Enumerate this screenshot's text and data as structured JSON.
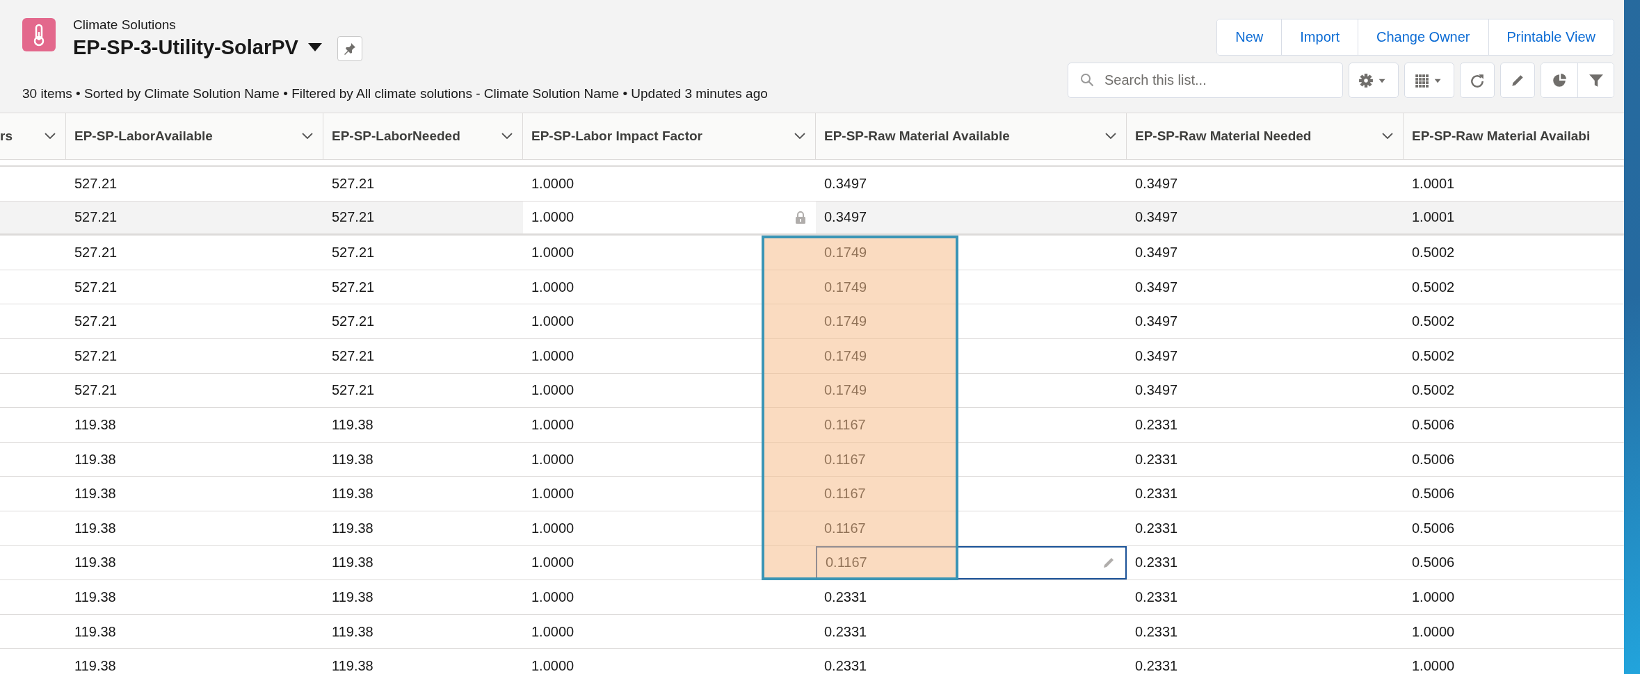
{
  "header": {
    "object_label": "Climate Solutions",
    "list_name": "EP-SP-3-Utility-SolarPV",
    "meta": "30 items • Sorted by Climate Solution Name • Filtered by All climate solutions - Climate Solution Name • Updated 3 minutes ago"
  },
  "actions": [
    "New",
    "Import",
    "Change Owner",
    "Printable View"
  ],
  "search": {
    "placeholder": "Search this list..."
  },
  "columns": [
    {
      "label": "rs",
      "menu": true
    },
    {
      "label": "EP-SP-LaborAvailable",
      "menu": true
    },
    {
      "label": "EP-SP-LaborNeeded",
      "menu": true
    },
    {
      "label": "EP-SP-Labor Impact Factor",
      "menu": true
    },
    {
      "label": "EP-SP-Raw Material Available",
      "menu": true
    },
    {
      "label": "EP-SP-Raw Material Needed",
      "menu": true
    },
    {
      "label": "EP-SP-Raw Material Availabi",
      "menu": false
    }
  ],
  "rows": [
    {
      "cells": [
        "527.21",
        "527.21",
        "1.0000",
        "0.3497",
        "0.3497",
        "1.0001"
      ],
      "hovered": false,
      "highlighted": false,
      "editing": false
    },
    {
      "cells": [
        "527.21",
        "527.21",
        "1.0000",
        "0.3497",
        "0.3497",
        "1.0001"
      ],
      "hovered": true,
      "highlighted": false,
      "editing": false
    },
    {
      "cells": [
        "527.21",
        "527.21",
        "1.0000",
        "0.1749",
        "0.3497",
        "0.5002"
      ],
      "hovered": false,
      "highlighted": true,
      "editing": false
    },
    {
      "cells": [
        "527.21",
        "527.21",
        "1.0000",
        "0.1749",
        "0.3497",
        "0.5002"
      ],
      "hovered": false,
      "highlighted": true,
      "editing": false
    },
    {
      "cells": [
        "527.21",
        "527.21",
        "1.0000",
        "0.1749",
        "0.3497",
        "0.5002"
      ],
      "hovered": false,
      "highlighted": true,
      "editing": false
    },
    {
      "cells": [
        "527.21",
        "527.21",
        "1.0000",
        "0.1749",
        "0.3497",
        "0.5002"
      ],
      "hovered": false,
      "highlighted": true,
      "editing": false
    },
    {
      "cells": [
        "527.21",
        "527.21",
        "1.0000",
        "0.1749",
        "0.3497",
        "0.5002"
      ],
      "hovered": false,
      "highlighted": true,
      "editing": false
    },
    {
      "cells": [
        "119.38",
        "119.38",
        "1.0000",
        "0.1167",
        "0.2331",
        "0.5006"
      ],
      "hovered": false,
      "highlighted": true,
      "editing": false
    },
    {
      "cells": [
        "119.38",
        "119.38",
        "1.0000",
        "0.1167",
        "0.2331",
        "0.5006"
      ],
      "hovered": false,
      "highlighted": true,
      "editing": false
    },
    {
      "cells": [
        "119.38",
        "119.38",
        "1.0000",
        "0.1167",
        "0.2331",
        "0.5006"
      ],
      "hovered": false,
      "highlighted": true,
      "editing": false
    },
    {
      "cells": [
        "119.38",
        "119.38",
        "1.0000",
        "0.1167",
        "0.2331",
        "0.5006"
      ],
      "hovered": false,
      "highlighted": true,
      "editing": false
    },
    {
      "cells": [
        "119.38",
        "119.38",
        "1.0000",
        "0.1167",
        "0.2331",
        "0.5006"
      ],
      "hovered": false,
      "highlighted": true,
      "editing": true
    },
    {
      "cells": [
        "119.38",
        "119.38",
        "1.0000",
        "0.2331",
        "0.2331",
        "1.0000"
      ],
      "hovered": false,
      "highlighted": false,
      "editing": false
    },
    {
      "cells": [
        "119.38",
        "119.38",
        "1.0000",
        "0.2331",
        "0.2331",
        "1.0000"
      ],
      "hovered": false,
      "highlighted": false,
      "editing": false
    },
    {
      "cells": [
        "119.38",
        "119.38",
        "1.0000",
        "0.2331",
        "0.2331",
        "1.0000"
      ],
      "hovered": false,
      "highlighted": false,
      "editing": false
    }
  ]
}
